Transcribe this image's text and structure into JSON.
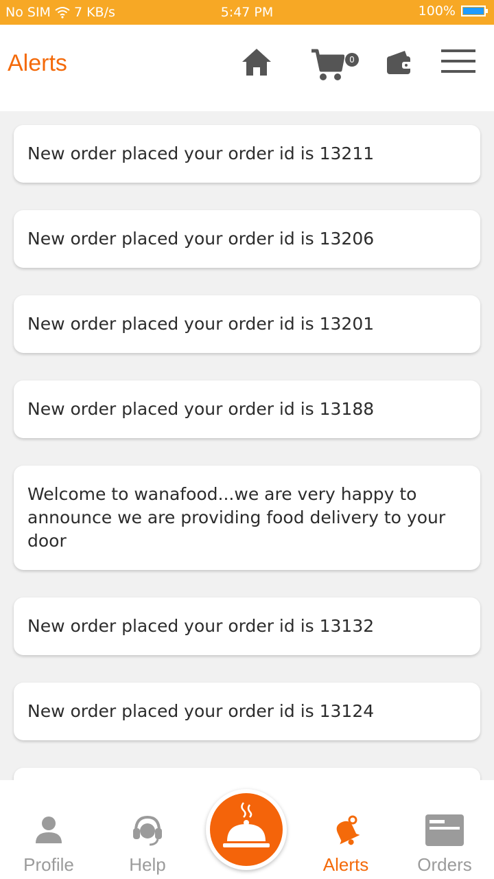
{
  "status_bar": {
    "carrier": "No SIM",
    "speed": "7 KB/s",
    "time": "5:47 PM",
    "battery": "100%",
    "battery_level": 1.0
  },
  "app_bar": {
    "title": "Alerts",
    "cart_count": "0",
    "icons": [
      "home-icon",
      "cart-icon",
      "wallet-icon",
      "menu-icon"
    ]
  },
  "alerts": [
    "New order placed your order id is 13211",
    "New order placed your order id is 13206",
    "New order placed your order id is 13201",
    "New order placed your order id is 13188",
    "Welcome to wanafood...we are very happy to announce we are  providing food delivery to your door",
    "New order placed your order id is 13132",
    "New order placed your order id is 13124",
    ""
  ],
  "bottom_nav": {
    "items": [
      {
        "label": "Profile",
        "icon": "person-icon"
      },
      {
        "label": "Help",
        "icon": "headset-icon"
      },
      {
        "label": "Alerts",
        "icon": "bell-icon",
        "active": true
      },
      {
        "label": "Orders",
        "icon": "orders-icon"
      }
    ],
    "center_icon": "food-cloche-icon"
  },
  "colors": {
    "accent": "#f46a0a",
    "status_bar": "#f7a825",
    "inactive": "#9b9b9b"
  }
}
